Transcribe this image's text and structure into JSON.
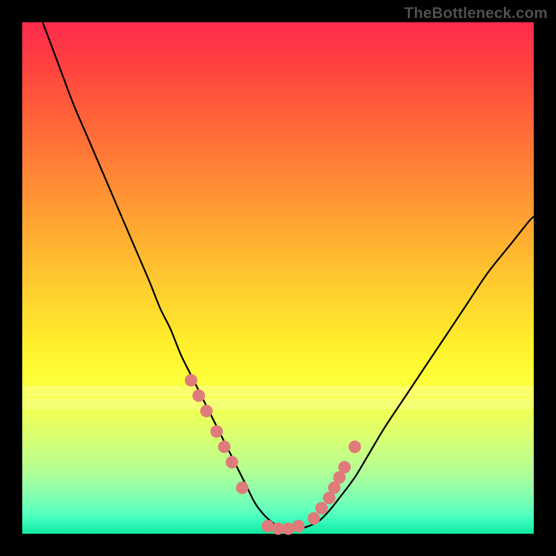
{
  "watermark": "TheBottleneck.com",
  "colors": {
    "frame": "#000000",
    "curve": "#000000",
    "dot_fill": "#e07b7b",
    "dot_stroke": "#b85a5a"
  },
  "chart_data": {
    "type": "line",
    "title": "",
    "xlabel": "",
    "ylabel": "",
    "xlim": [
      0,
      100
    ],
    "ylim": [
      0,
      100
    ],
    "grid": false,
    "series": [
      {
        "name": "curve",
        "x": [
          4,
          7,
          10,
          13,
          16,
          19,
          22,
          25,
          27,
          29,
          31,
          33,
          35,
          37,
          39,
          41,
          42.5,
          44,
          45.5,
          47,
          48.5,
          50,
          52,
          54,
          56,
          58,
          60,
          62,
          65,
          68,
          71,
          75,
          79,
          83,
          87,
          91,
          95,
          99,
          100
        ],
        "y": [
          100,
          92,
          84,
          77,
          70,
          63,
          56,
          49,
          44,
          40,
          35,
          31,
          27,
          23,
          19,
          15,
          12,
          9,
          6,
          4,
          2.5,
          1.5,
          1,
          1,
          1.5,
          2.5,
          4.5,
          7,
          11,
          16,
          21,
          27,
          33,
          39,
          45,
          51,
          56,
          61,
          62
        ]
      }
    ],
    "dots": {
      "name": "markers",
      "x": [
        33,
        34.5,
        36,
        38,
        39.5,
        41,
        43,
        48,
        50,
        52,
        54,
        57,
        58.5,
        60,
        61,
        62,
        63,
        65
      ],
      "y": [
        30,
        27,
        24,
        20,
        17,
        14,
        9,
        1.5,
        1,
        1,
        1.5,
        3,
        5,
        7,
        9,
        11,
        13,
        17
      ]
    },
    "pale_bands_y": [
      71,
      73.5
    ]
  }
}
